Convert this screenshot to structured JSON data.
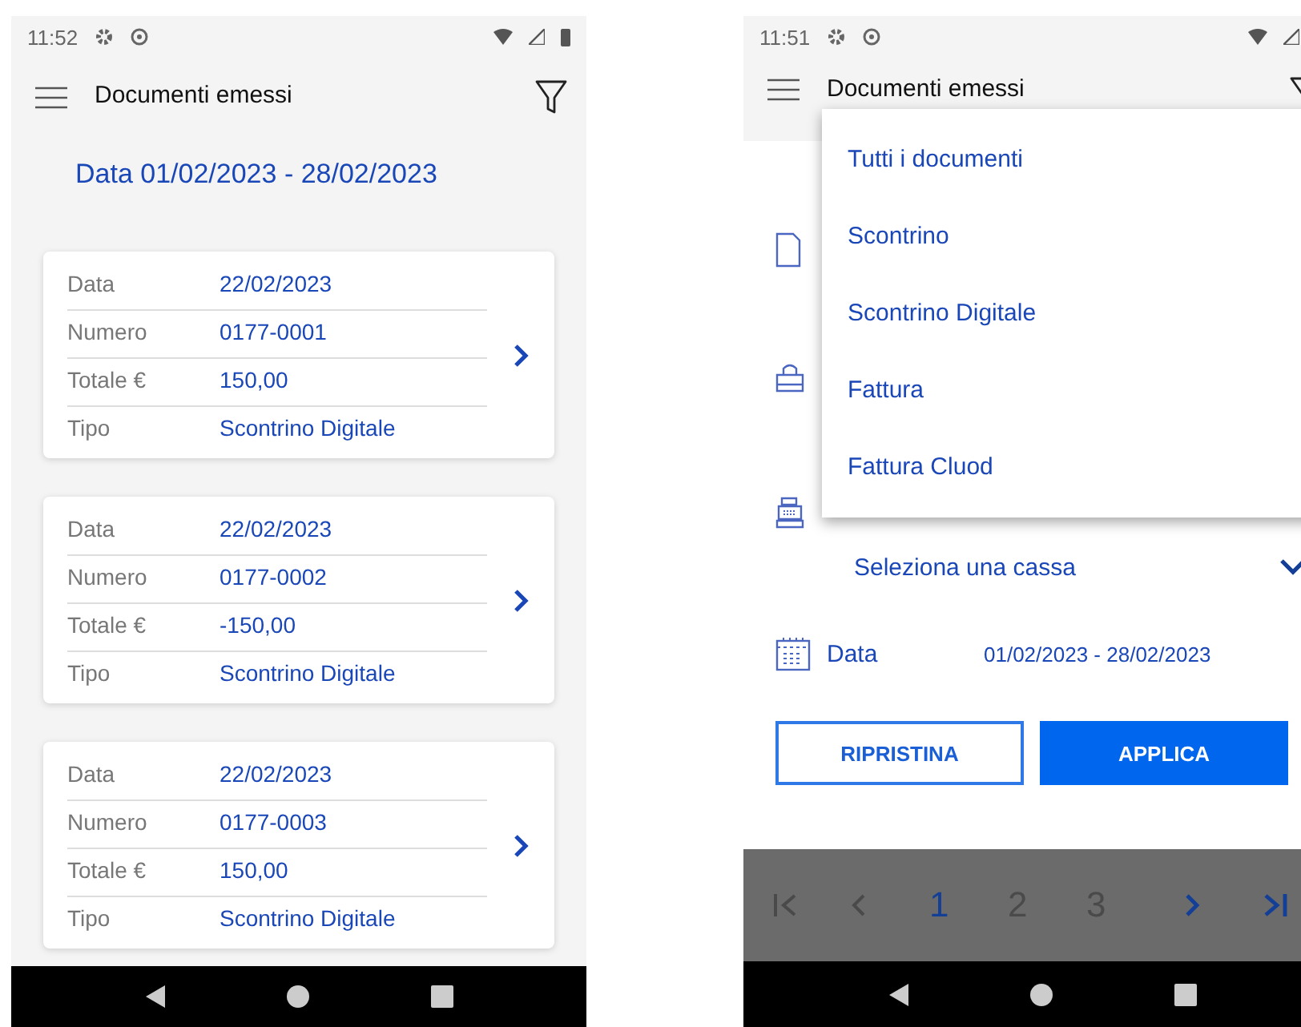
{
  "list_screen": {
    "status_bar": {
      "time": "11:52"
    },
    "app_bar": {
      "title": "Documenti emessi"
    },
    "date_range": "Data 01/02/2023 - 28/02/2023",
    "documents": [
      {
        "fields": [
          {
            "label": "Data",
            "value": "22/02/2023"
          },
          {
            "label": "Numero",
            "value": "0177-0001"
          },
          {
            "label": "Totale €",
            "value": "150,00"
          },
          {
            "label": "Tipo",
            "value": "Scontrino Digitale"
          }
        ]
      },
      {
        "fields": [
          {
            "label": "Data",
            "value": "22/02/2023"
          },
          {
            "label": "Numero",
            "value": "0177-0002"
          },
          {
            "label": "Totale €",
            "value": "-150,00"
          },
          {
            "label": "Tipo",
            "value": "Scontrino Digitale"
          }
        ]
      },
      {
        "fields": [
          {
            "label": "Data",
            "value": "22/02/2023"
          },
          {
            "label": "Numero",
            "value": "0177-0003"
          },
          {
            "label": "Totale €",
            "value": "150,00"
          },
          {
            "label": "Tipo",
            "value": "Scontrino Digitale"
          }
        ]
      }
    ]
  },
  "filter_screen": {
    "status_bar": {
      "time": "11:51"
    },
    "app_bar": {
      "title": "Documenti emessi"
    },
    "menu": {
      "items": [
        {
          "label": "Tutti i documenti"
        },
        {
          "label": "Scontrino"
        },
        {
          "label": "Scontrino Digitale"
        },
        {
          "label": "Fattura"
        },
        {
          "label": "Fattura Cluod"
        }
      ]
    },
    "cassa_select": {
      "value": "Seleziona una cassa"
    },
    "date_filter": {
      "label": "Data",
      "value": "01/02/2023 - 28/02/2023"
    },
    "buttons": [
      {
        "label": "RIPRISTINA",
        "kind": "outline"
      },
      {
        "label": "APPLICA",
        "kind": "primary"
      }
    ],
    "pagination": {
      "pages": [
        {
          "label": "1",
          "selected": true
        },
        {
          "label": "2",
          "selected": false
        },
        {
          "label": "3",
          "selected": false
        }
      ]
    }
  }
}
